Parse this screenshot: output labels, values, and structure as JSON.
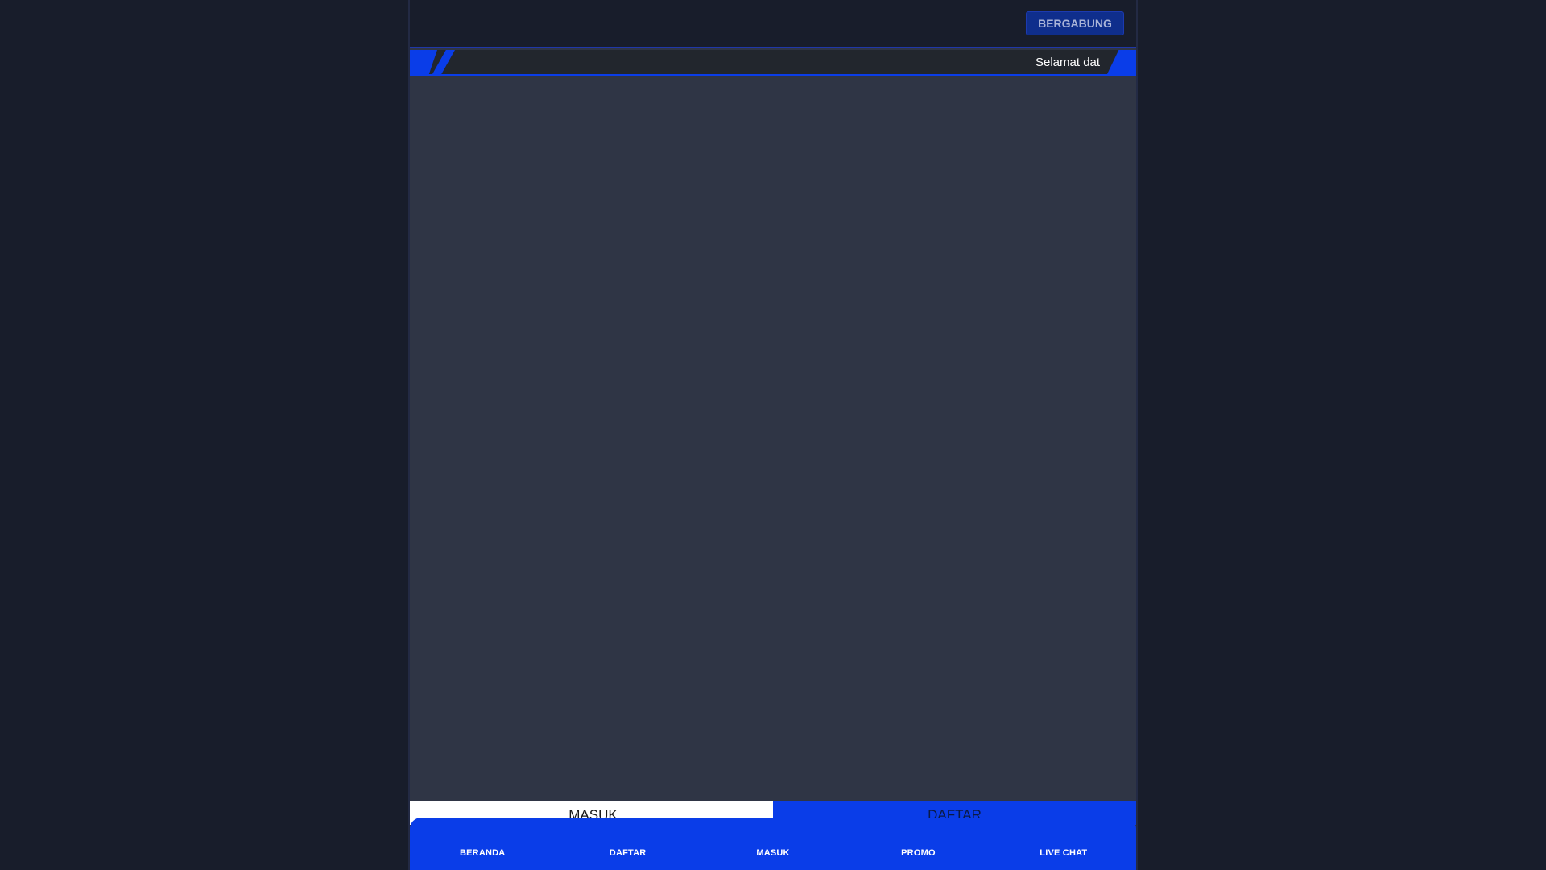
{
  "header": {
    "join_label": "BERGABUNG"
  },
  "ticker": {
    "icon": "announcement-icon",
    "icon_glyph": "",
    "text": "Selamat dat"
  },
  "auth": {
    "login_icon": "login-icon",
    "login_glyph": "",
    "login_label": "MASUK",
    "register_label": "DAFTAR"
  },
  "bottom_nav": {
    "items": [
      {
        "label": "BERANDA",
        "icon": "home-icon",
        "glyph": ""
      },
      {
        "label": "DAFTAR",
        "icon": "register-icon",
        "glyph": ""
      },
      {
        "label": "MASUK",
        "icon": "login-icon",
        "glyph": ""
      },
      {
        "label": "PROMO",
        "icon": "gift-icon",
        "glyph": ""
      },
      {
        "label": "LIVE CHAT",
        "icon": "chat-icon",
        "glyph": ""
      }
    ]
  },
  "colors": {
    "page_bg": "#181d2b",
    "content_bg": "#2f3545",
    "accent": "#0a3de8",
    "button_bg": "#0f2e8c"
  }
}
